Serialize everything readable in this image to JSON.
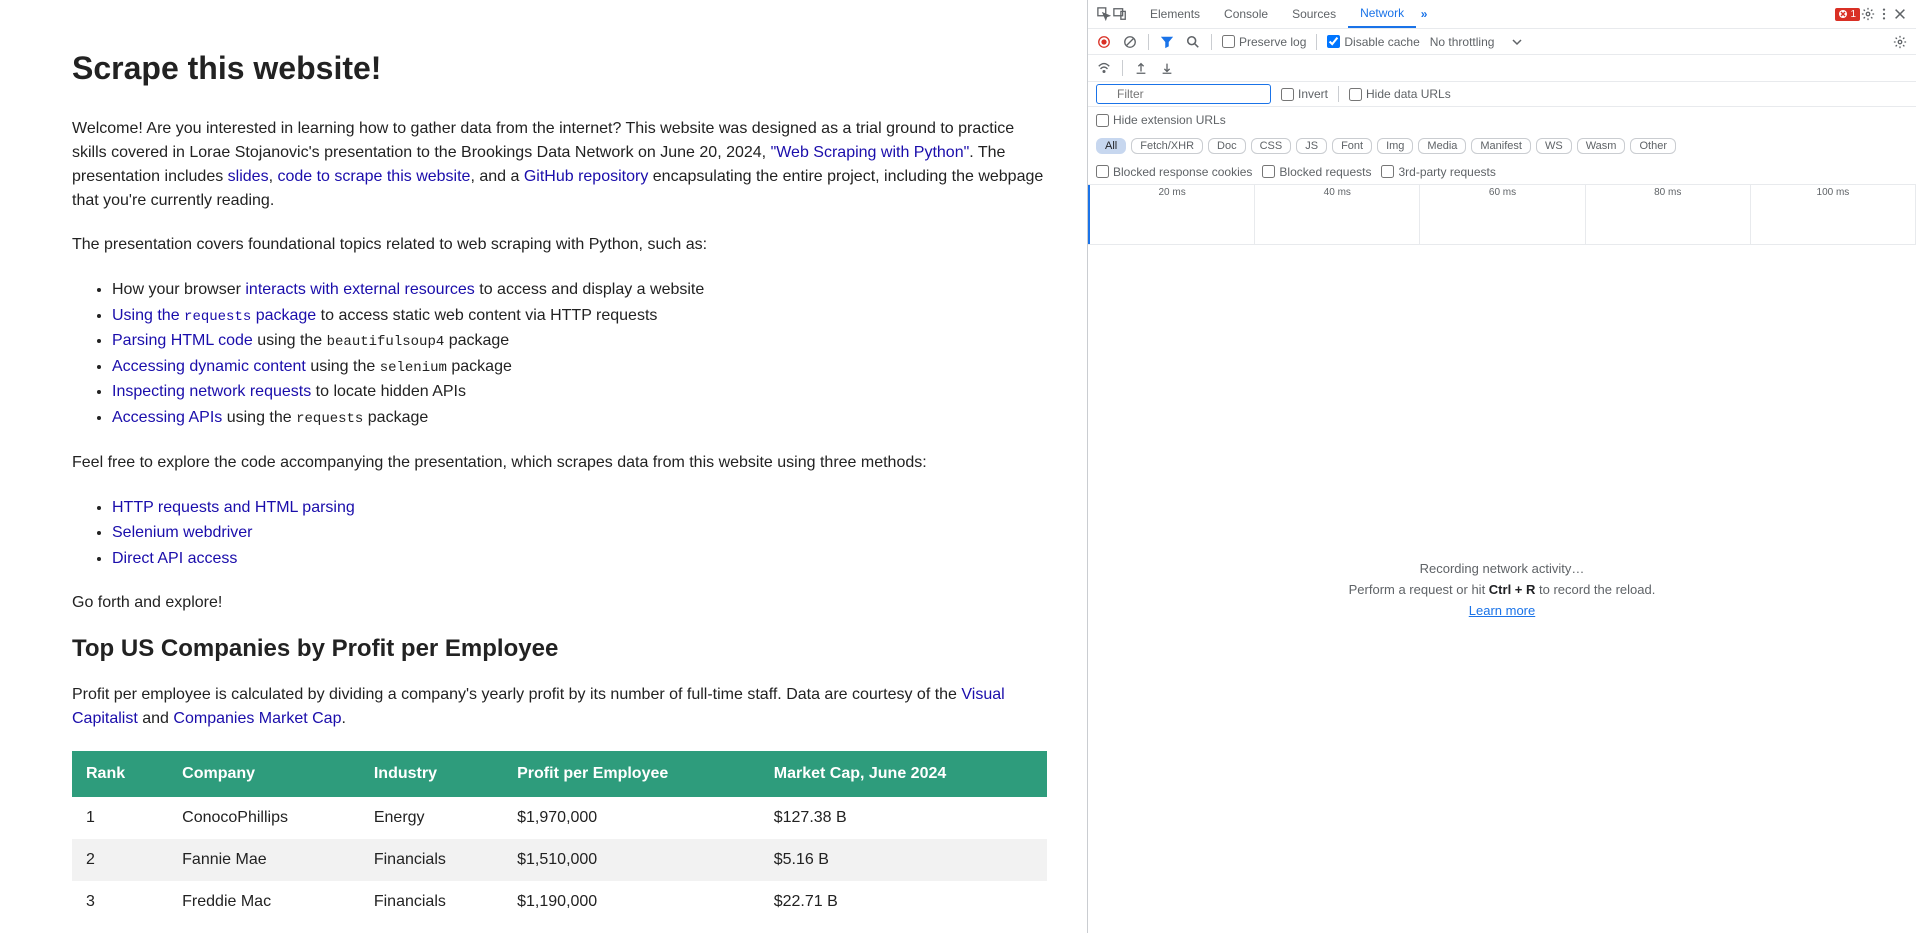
{
  "page": {
    "title": "Scrape this website!",
    "intro_1": "Welcome! Are you interested in learning how to gather data from the internet? This website was designed as a trial ground to practice skills covered in Lorae Stojanovic's presentation to the Brookings Data Network on June 20, 2024, ",
    "intro_link1": "\"Web Scraping with Python\"",
    "intro_2": ". The presentation includes ",
    "slides": "slides",
    "intro_3": ", ",
    "code_link": "code to scrape this website",
    "intro_4": ", and a ",
    "github": "GitHub repository",
    "intro_5": " encapsulating the entire project, including the webpage that you're currently reading.",
    "topics_intro": "The presentation covers foundational topics related to web scraping with Python, such as:",
    "bullets1": {
      "b1a": "How your browser ",
      "b1link": "interacts with external resources",
      "b1b": " to access and display a website",
      "b2link": "Using the ",
      "b2code": "requests",
      "b2link2": " package",
      "b2b": " to access static web content via HTTP requests",
      "b3link": "Parsing HTML code",
      "b3b": " using the ",
      "b3code": "beautifulsoup4",
      "b3c": " package",
      "b4link": "Accessing dynamic content",
      "b4b": " using the ",
      "b4code": "selenium",
      "b4c": " package",
      "b5link": "Inspecting network requests",
      "b5b": " to locate hidden APIs",
      "b6link": "Accessing APIs",
      "b6b": " using the ",
      "b6code": "requests",
      "b6c": " package"
    },
    "methods_intro": "Feel free to explore the code accompanying the presentation, which scrapes data from this website using three methods:",
    "methods": [
      "HTTP requests and HTML parsing",
      "Selenium webdriver",
      "Direct API access"
    ],
    "goforth": "Go forth and explore!",
    "h2": "Top US Companies by Profit per Employee",
    "profit_intro_1": "Profit per employee is calculated by dividing a company's yearly profit by its number of full-time staff. Data are courtesy of the ",
    "vc": "Visual Capitalist",
    "profit_intro_2": " and ",
    "cmc": "Companies Market Cap",
    "profit_intro_3": ".",
    "table": {
      "headers": [
        "Rank",
        "Company",
        "Industry",
        "Profit per Employee",
        "Market Cap, June 2024"
      ],
      "rows": [
        [
          "1",
          "ConocoPhillips",
          "Energy",
          "$1,970,000",
          "$127.38 B"
        ],
        [
          "2",
          "Fannie Mae",
          "Financials",
          "$1,510,000",
          "$5.16 B"
        ],
        [
          "3",
          "Freddie Mac",
          "Financials",
          "$1,190,000",
          "$22.71 B"
        ]
      ]
    }
  },
  "devtools": {
    "tabs": [
      "Elements",
      "Console",
      "Sources",
      "Network"
    ],
    "active_tab": "Network",
    "errors": "1",
    "preserve_log": "Preserve log",
    "disable_cache": "Disable cache",
    "throttling": "No throttling",
    "filter_placeholder": "Filter",
    "invert": "Invert",
    "hide_data_urls": "Hide data URLs",
    "hide_ext": "Hide extension URLs",
    "type_filters": [
      "All",
      "Fetch/XHR",
      "Doc",
      "CSS",
      "JS",
      "Font",
      "Img",
      "Media",
      "Manifest",
      "WS",
      "Wasm",
      "Other"
    ],
    "blocked_cookies": "Blocked response cookies",
    "blocked_requests": "Blocked requests",
    "third_party": "3rd-party requests",
    "ticks": [
      "20 ms",
      "40 ms",
      "60 ms",
      "80 ms",
      "100 ms"
    ],
    "recording": "Recording network activity…",
    "hint_1": "Perform a request or hit ",
    "hint_kbd": "Ctrl + R",
    "hint_2": " to record the reload.",
    "learn": "Learn more"
  }
}
